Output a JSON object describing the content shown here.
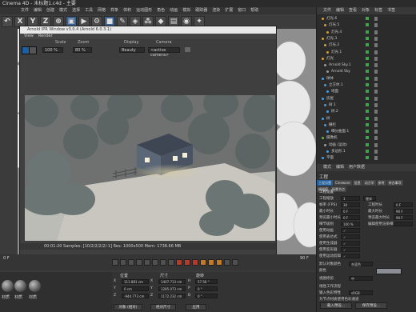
{
  "window": {
    "title": "Cinema 4D - 未标题1.c4d - 主要"
  },
  "menubar": {
    "items": [
      "文件",
      "编辑",
      "创建",
      "模式",
      "选择",
      "工具",
      "网格",
      "样条",
      "体积",
      "运动图形",
      "角色",
      "动画",
      "模拟",
      "跟踪器",
      "渲染",
      "扩展",
      "窗口",
      "帮助"
    ]
  },
  "toolbar": {
    "buttons": [
      "X",
      "Y",
      "Z"
    ]
  },
  "ipr": {
    "title": "Arnold IPR Window v3.0.4 (Arnold 6.0.3.1)",
    "menu": [
      "View",
      "Render"
    ],
    "labels": {
      "scale": "Scale",
      "zoom": "Zoom",
      "display": "Display",
      "camera": "Camera"
    },
    "scale_value": "100 %",
    "zoom_value": "80 %",
    "display_value": "Beauty",
    "camera_value": "<active camera>",
    "status": "00:01:20   Samples: [10/2/2/2/2/-1]  Res: 1000x500  Mem: 1738.66 MB"
  },
  "timeline": {
    "frame": "0 F",
    "end": "90 F"
  },
  "materials": {
    "labels": [
      "材质",
      "材质",
      "材质"
    ]
  },
  "coords": {
    "headers": [
      "位置",
      "尺寸",
      "旋转"
    ],
    "rows": [
      [
        "X",
        "111.881 cm",
        "X",
        "1407.713 cm",
        "H",
        "57.56 °"
      ],
      [
        "Y",
        "0 cm",
        "Y",
        "1285.073 cm",
        "P",
        "0 °"
      ],
      [
        "Z",
        "-944.773 cm",
        "Z",
        "1172.232 cm",
        "B",
        "0 °"
      ]
    ],
    "mode": "对象 (相对)",
    "size_mode": "绝对尺寸",
    "apply": "应用"
  },
  "rightpanel": {
    "tabs": [
      "文件",
      "编辑",
      "查看",
      "对象",
      "标签",
      "书签"
    ],
    "objects": [
      "灯光.6",
      "灯光.5",
      "灯光.4",
      "灯光.3",
      "灯光.2",
      "灯光.1",
      "灯光",
      "Arnold Sky.1",
      "Arnold Sky",
      "球体",
      "立方体.1",
      "地面",
      "房屋",
      "树.1",
      "树.2",
      "树",
      "栅栏",
      "细分曲面.1",
      "摄像机",
      "动画 (运动)",
      "多边形.1",
      "平面"
    ],
    "attr_tabs": [
      "模式",
      "编辑",
      "用户数据"
    ],
    "attr_title": "工程",
    "attr_subtabs": [
      "工程设置",
      "Cineware",
      "信息",
      "动力学",
      "参考",
      "待办事项",
      "帧插值",
      "场景节点"
    ],
    "attr_section": "工程设置",
    "fields": [
      {
        "label": "工程缩放",
        "value": "1",
        "unit": "厘米"
      },
      {
        "label": "帧率 (FPS)",
        "value": "30"
      },
      {
        "label": "最小时长",
        "value": "0 F"
      },
      {
        "label": "预览最小时长",
        "value": "0 F"
      },
      {
        "label": "细节级别",
        "value": "100 %"
      },
      {
        "label": "使用动画",
        "value": "✓"
      },
      {
        "label": "使用表达式",
        "value": "✓"
      },
      {
        "label": "使用生成器",
        "value": "✓"
      },
      {
        "label": "使用变形器",
        "value": "✓"
      },
      {
        "label": "使用运动剪辑系统",
        "value": "✓"
      }
    ],
    "right_fields": [
      {
        "label": "工程时长",
        "value": "0 F"
      },
      {
        "label": "最大时长",
        "value": "90 F"
      },
      {
        "label": "预览最大时长",
        "value": "90 F"
      },
      {
        "label": "编辑使用渲染细节级别",
        "value": ""
      }
    ],
    "color_label": "默认对象颜色",
    "color_value": "灰蓝色",
    "color2_label": "颜色",
    "view_label": "视图修剪",
    "view_value": "中",
    "linear_label": "线性工作流程",
    "input_label": "输入色彩特性",
    "input_value": "sRGB",
    "checkbox_label": "为节点材质使用色彩通道",
    "btn_load": "载入预设...",
    "btn_save": "保存预设..."
  }
}
